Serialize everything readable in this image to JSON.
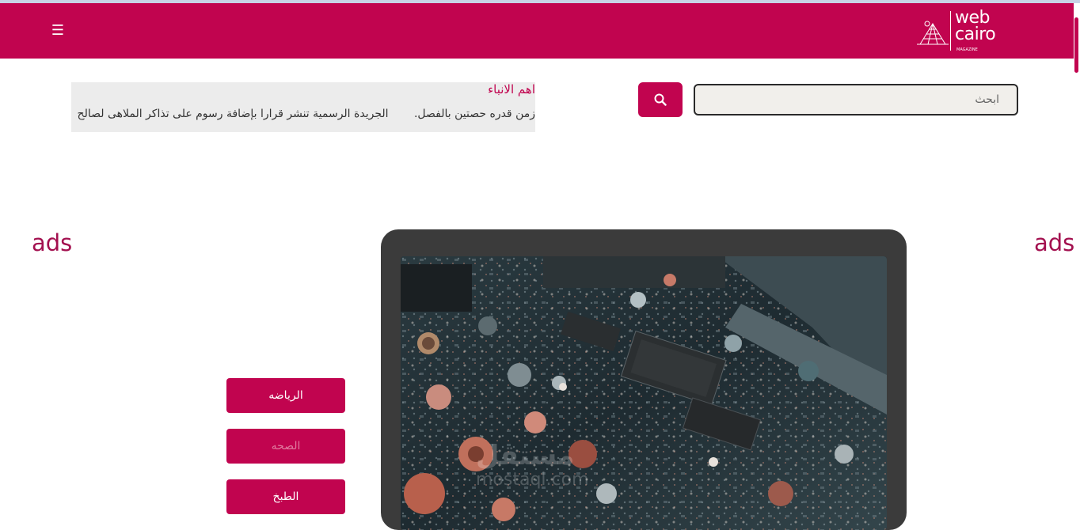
{
  "header": {
    "menu_icon": "☰",
    "logo": {
      "line1": "web",
      "line2": "cairo",
      "subtitle": "MAGAZINE"
    },
    "brand_color": "#c1044f"
  },
  "search": {
    "placeholder": "ابحث",
    "button_icon": "search-icon"
  },
  "news": {
    "title": "اهم الانباء",
    "items": [
      "الجريدة الرسمية تنشر قرارا بإضافة رسوم على تذاكر الملاهى لصالح",
      "زمن قدره حصتين بالفصل."
    ]
  },
  "ads": {
    "left": "ads",
    "right": "ads"
  },
  "watermark": {
    "arabic": "مستقل",
    "latin": "mostaql.com"
  },
  "categories": [
    "الرياضه",
    "الصحه",
    "الطبخ"
  ]
}
